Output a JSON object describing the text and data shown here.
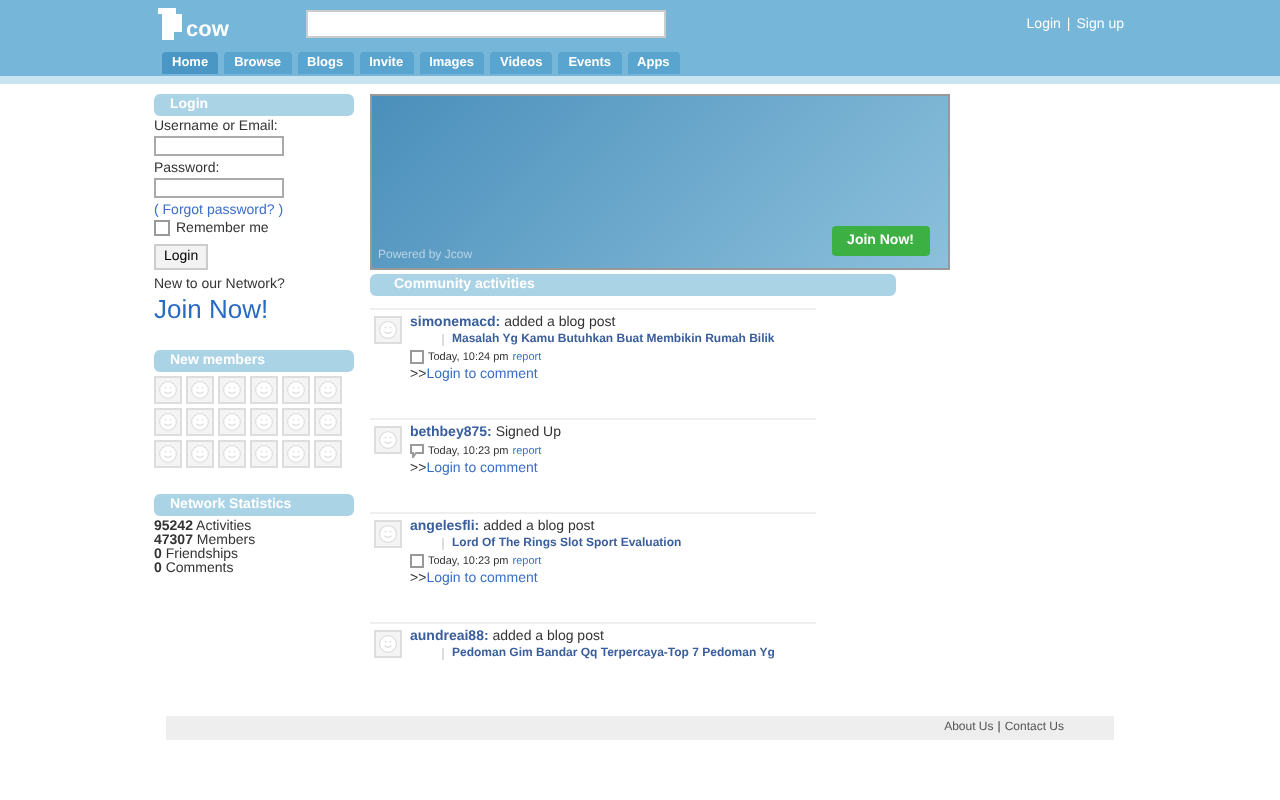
{
  "header": {
    "logo": "cow",
    "user_links": [
      "Login",
      "Sign up"
    ],
    "separator": "|"
  },
  "nav_tabs": [
    {
      "label": "Home",
      "selected": true
    },
    {
      "label": "Browse",
      "selected": false
    },
    {
      "label": "Blogs",
      "selected": false
    },
    {
      "label": "Invite",
      "selected": false
    },
    {
      "label": "Images",
      "selected": false
    },
    {
      "label": "Videos",
      "selected": false
    },
    {
      "label": "Events",
      "selected": false
    },
    {
      "label": "Apps",
      "selected": false
    }
  ],
  "login": {
    "title": "Login",
    "username_label": "Username or Email:",
    "password_label": "Password:",
    "forgot": "( Forgot password? )",
    "remember": {
      "label": "Remember me",
      "checked": false
    },
    "button": "Login",
    "new_prompt": "New to our Network?",
    "join": "Join Now!"
  },
  "new_members": {
    "title": "New members"
  },
  "stats": {
    "title": "Network Statistics",
    "items": [
      "**95242** Activities",
      "**47307** Members",
      "**0** Friendships",
      "**0** Comments"
    ]
  },
  "banner": {
    "caption": "Powered by Jcow",
    "button": "Join Now!"
  },
  "community": {
    "title": "Community activities",
    "items": [
      {
        "kind": "blog",
        "user": "simonemacd:",
        "action": "added a blog post",
        "post": "Masalah Yg Kamu Butuhkan Buat Membikin Rumah Bilik",
        "time": "Today, 10:24 pm",
        "report": "report",
        "comment_prefix": ">>",
        "comment": "Login to comment"
      },
      {
        "kind": "signup",
        "user": "bethbey875:",
        "action": "Signed Up",
        "time": "Today, 10:23 pm",
        "report": "report",
        "comment_prefix": ">>",
        "comment": "Login to comment"
      },
      {
        "kind": "blog",
        "user": "angelesfli:",
        "action": "added a blog post",
        "post": "Lord Of The Rings Slot Sport Evaluation",
        "time": "Today, 10:23 pm",
        "report": "report",
        "comment_prefix": ">>",
        "comment": "Login to comment"
      },
      {
        "kind": "blog",
        "user": "aundreai88:",
        "action": "added a blog post",
        "post": "Pedoman Gim Bandar Qq Terpercaya-Top 7 Pedoman Yg"
      }
    ]
  },
  "footer": {
    "links": [
      "About Us",
      "Contact Us"
    ],
    "separator": "|"
  }
}
